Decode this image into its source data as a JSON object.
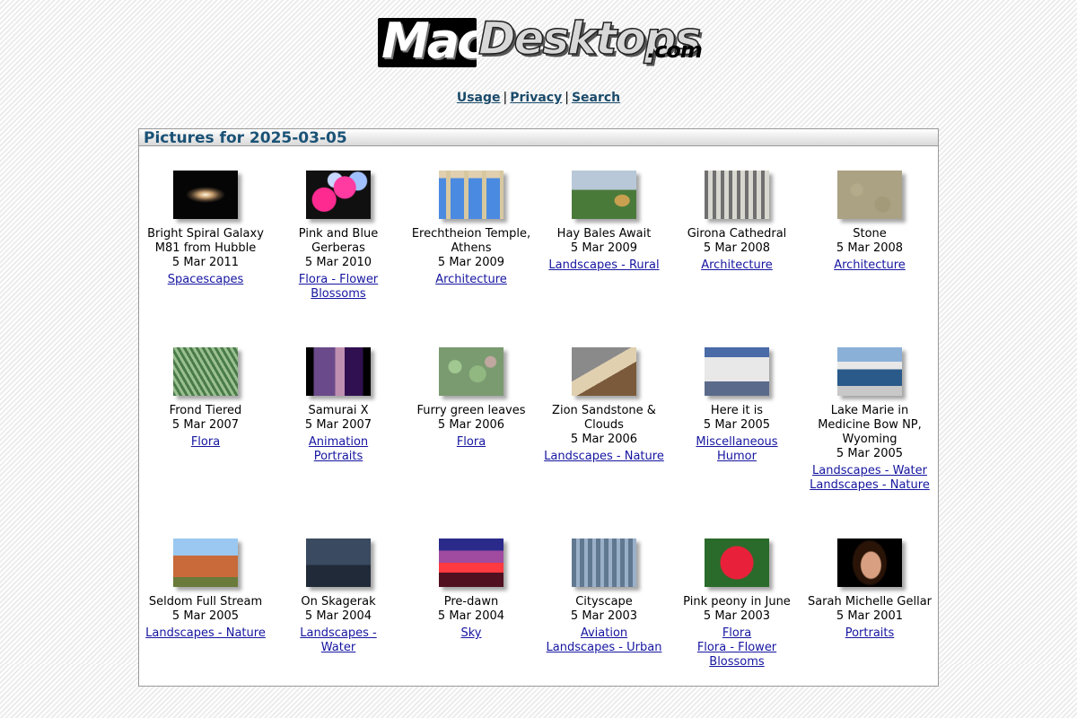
{
  "site": {
    "title_mac": "Mac",
    "title_desktops": "Desktops",
    "title_com": ".com"
  },
  "nav": {
    "usage": "Usage",
    "privacy": "Privacy",
    "search": "Search",
    "separator": "|"
  },
  "page_title": "Pictures for 2025-03-05",
  "pictures": [
    {
      "title": "Bright Spiral Galaxy M81 from Hubble",
      "date": "5 Mar 2011",
      "categories": [
        "Spacescapes"
      ],
      "thumb": "galaxy"
    },
    {
      "title": "Pink and Blue Gerberas",
      "date": "5 Mar 2010",
      "categories": [
        "Flora - Flower Blossoms"
      ],
      "thumb": "gerbera"
    },
    {
      "title": "Erechtheion Temple, Athens",
      "date": "5 Mar 2009",
      "categories": [
        "Architecture"
      ],
      "thumb": "temple"
    },
    {
      "title": "Hay Bales Await",
      "date": "5 Mar 2009",
      "categories": [
        "Landscapes - Rural"
      ],
      "thumb": "hay"
    },
    {
      "title": "Girona Cathedral",
      "date": "5 Mar 2008",
      "categories": [
        "Architecture"
      ],
      "thumb": "cathedral"
    },
    {
      "title": "Stone",
      "date": "5 Mar 2008",
      "categories": [
        "Architecture"
      ],
      "thumb": "stone"
    },
    {
      "title": "Frond Tiered",
      "date": "5 Mar 2007",
      "categories": [
        "Flora"
      ],
      "thumb": "frond"
    },
    {
      "title": "Samurai X",
      "date": "5 Mar 2007",
      "categories": [
        "Animation",
        "Portraits"
      ],
      "thumb": "samurai"
    },
    {
      "title": "Furry green leaves",
      "date": "5 Mar 2006",
      "categories": [
        "Flora"
      ],
      "thumb": "leaves"
    },
    {
      "title": "Zion Sandstone & Clouds",
      "date": "5 Mar 2006",
      "categories": [
        "Landscapes - Nature"
      ],
      "thumb": "zion"
    },
    {
      "title": "Here it is",
      "date": "5 Mar 2005",
      "categories": [
        "Miscellaneous",
        "Humor"
      ],
      "thumb": "sign"
    },
    {
      "title": "Lake Marie in Medicine Bow NP, Wyoming",
      "date": "5 Mar 2005",
      "categories": [
        "Landscapes - Water",
        "Landscapes - Nature"
      ],
      "thumb": "lake"
    },
    {
      "title": "Seldom Full Stream",
      "date": "5 Mar 2005",
      "categories": [
        "Landscapes - Nature"
      ],
      "thumb": "stream"
    },
    {
      "title": "On Skagerak",
      "date": "5 Mar 2004",
      "categories": [
        "Landscapes - Water"
      ],
      "thumb": "skagerak"
    },
    {
      "title": "Pre-dawn",
      "date": "5 Mar 2004",
      "categories": [
        "Sky"
      ],
      "thumb": "predawn"
    },
    {
      "title": "Cityscape",
      "date": "5 Mar 2003",
      "categories": [
        "Aviation",
        "Landscapes - Urban"
      ],
      "thumb": "city"
    },
    {
      "title": "Pink peony in June",
      "date": "5 Mar 2003",
      "categories": [
        "Flora",
        "Flora - Flower Blossoms"
      ],
      "thumb": "peony"
    },
    {
      "title": "Sarah Michelle Gellar",
      "date": "5 Mar 2001",
      "categories": [
        "Portraits"
      ],
      "thumb": "portrait"
    }
  ]
}
